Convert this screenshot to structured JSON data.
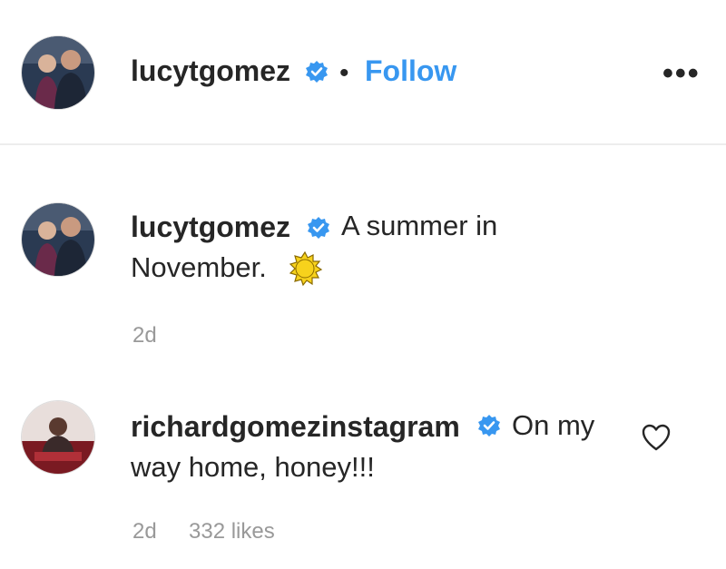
{
  "header": {
    "username": "lucytgomez",
    "separator": "•",
    "follow_label": "Follow",
    "more_label": "•••"
  },
  "caption": {
    "username": "lucytgomez",
    "text_line1": "A summer in",
    "text_line2": "November.",
    "emoji": "sun-emoji",
    "time": "2d"
  },
  "comment": {
    "username": "richardgomezinstagram",
    "text_line1": "On my",
    "text_line2": "way home, honey!!!",
    "time": "2d",
    "likes": "332 likes"
  },
  "colors": {
    "link_blue": "#3897f0",
    "verified_blue": "#3897f0",
    "muted": "#999999",
    "sun": "#f7d21c"
  },
  "icons": [
    "verified-badge-icon",
    "more-options-icon",
    "heart-icon",
    "sun-emoji"
  ]
}
